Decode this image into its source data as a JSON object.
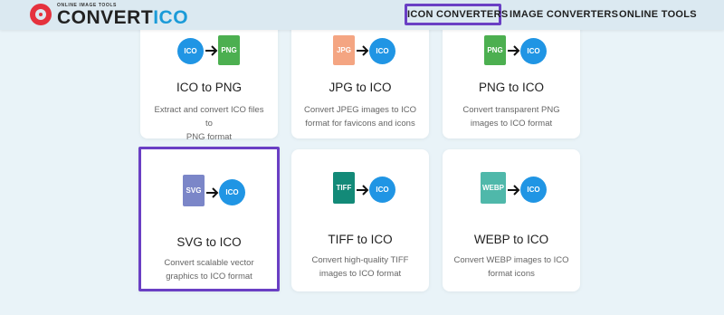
{
  "header": {
    "logo_tagline": "ONLINE IMAGE TOOLS",
    "logo_part1": "CONVERT",
    "logo_part2": "ICO",
    "nav": [
      {
        "label": "ICON CONVERTERS",
        "active": true
      },
      {
        "label": "IMAGE CONVERTERS",
        "active": false
      },
      {
        "label": "ONLINE TOOLS",
        "active": false
      }
    ]
  },
  "cards": [
    {
      "title": "ICO to PNG",
      "desc1": "Extract and convert ICO files to",
      "desc2": "PNG format",
      "from": "ICO",
      "to": "PNG",
      "selected": false
    },
    {
      "title": "JPG to ICO",
      "desc1": "Convert JPEG images to ICO",
      "desc2": "format for favicons and icons",
      "from": "JPG",
      "to": "ICO",
      "selected": false
    },
    {
      "title": "PNG to ICO",
      "desc1": "Convert transparent PNG",
      "desc2": "images to ICO format",
      "from": "PNG",
      "to": "ICO",
      "selected": false
    },
    {
      "title": "SVG to ICO",
      "desc1": "Convert scalable vector",
      "desc2": "graphics to ICO format",
      "from": "SVG",
      "to": "ICO",
      "selected": true
    },
    {
      "title": "TIFF to ICO",
      "desc1": "Convert high-quality TIFF",
      "desc2": "images to ICO format",
      "from": "TIFF",
      "to": "ICO",
      "selected": false
    },
    {
      "title": "WEBP to ICO",
      "desc1": "Convert WEBP images to ICO",
      "desc2": "format icons",
      "from": "WEBP",
      "to": "ICO",
      "selected": false
    }
  ],
  "colors": {
    "accent": "#6a3fc4",
    "ico_blue": "#2095e4",
    "png_green": "#4caf50",
    "jpg_salmon": "#f4a582",
    "svg_purple": "#7b86c8",
    "tiff_teal": "#138a78",
    "webp_teal": "#4fb8aa"
  },
  "icons": [
    "arrow-right-icon",
    "logo-icon"
  ]
}
